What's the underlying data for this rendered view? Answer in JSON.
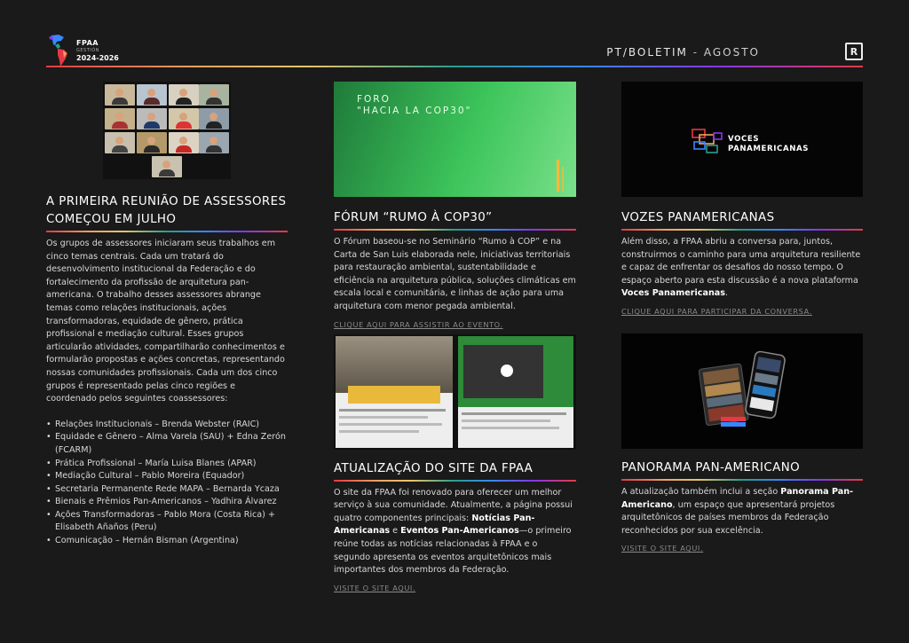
{
  "header": {
    "logo": {
      "line1": "FPAA",
      "line2": "GESTIÓN",
      "line3": "2024-2026"
    },
    "title": "PT/BOLETIM",
    "separator": "-",
    "month": "AGOSTO",
    "icon_letter": "R"
  },
  "col1": {
    "heading_line1": "A PRIMEIRA REUNIÃO DE ASSESSORES",
    "heading_line2": "COMEÇOU EM JULHO",
    "body": "Os grupos de assessores iniciaram seus trabalhos em cinco temas centrais. Cada um tratará do desenvolvimento institucional da Federação e do fortalecimento da profissão de arquitetura pan-americana. O trabalho desses assessores abrange temas como relações institucionais, ações transformadoras, equidade de gênero, prática profissional e mediação cultural. Esses grupos articularão atividades, compartilharão conhecimentos e formularão propostas e ações concretas, representando nossas comunidades profissionais. Cada um dos cinco grupos é representado pelas cinco regiões e coordenado pelos seguintes coassessores:",
    "bullets": [
      "Relações Institucionais – Brenda Webster (RAIC)",
      "Equidade e Gênero – Alma Varela (SAU) + Edna Zerón (FCARM)",
      "Prática Profissional – María Luisa Blanes (APAR)",
      "Mediação Cultural – Pablo Moreira (Equador)",
      "Secretaria Permanente Rede MAPA – Bernarda Ycaza",
      "Bienais e Prêmios Pan-Americanos – Yadhira Álvarez",
      "Ações Transformadoras – Pablo Mora (Costa Rica) + Elisabeth Añaños (Peru)",
      "Comunicação – Hernán Bisman (Argentina)"
    ]
  },
  "col2": {
    "banner_title": "FORO\n\"HACIA LA COP30\"",
    "heading1": "FÓRUM “RUMO À COP30”",
    "body1": "O Fórum baseou-se no Seminário “Rumo à COP” e na Carta de San Luis elaborada nele, iniciativas territoriais para restauração ambiental, sustentabilidade e eficiência na arquitetura pública, soluções climáticas em escala local e comunitária, e linhas de ação para uma arquitetura com menor pegada ambiental.",
    "link1": "CLIQUE AQUI PARA ASSISTIR AO EVENTO.",
    "heading2": "ATUALIZAÇÃO DO SITE DA FPAA",
    "body2_a": "O site da FPAA foi renovado para oferecer um melhor serviço à sua comunidade. Atualmente, a página possui quatro componentes principais: ",
    "body2_b1": "Notícias Pan-Americanas",
    "body2_c": " e ",
    "body2_b2": "Eventos Pan-Americanos",
    "body2_d": "—o primeiro reúne todas as notícias relacionadas à FPAA e o segundo apresenta os eventos arquitetônicos mais importantes dos membros da Federação.",
    "link2": "VISITE O SITE AQUI."
  },
  "col3": {
    "voces_logo": "VOCES\nPANAMERICANAS",
    "heading1": "VOZES PANAMERICANAS",
    "body1_a": "Além disso, a FPAA abriu a conversa para, juntos, construirmos o caminho para uma arquitetura resiliente e capaz de enfrentar os desafios do nosso tempo. O espaço aberto para esta discussão é a nova plataforma ",
    "body1_b": "Voces Panamericanas",
    "body1_c": ".",
    "link1": "CLIQUE AQUI PARA PARTICIPAR DA CONVERSA.",
    "heading2": "PANORAMA PAN-AMERICANO",
    "body2_a": "A atualização também inclui a seção ",
    "body2_b": "Panorama Pan-Americano",
    "body2_c": ", um espaço que apresentará projetos arquitetônicos de países membros da Federação reconhecidos por sua excelência.",
    "link2": "VISITE O SITE AQUI."
  },
  "colors": {
    "background": "#1a1a1a",
    "green_banner": "#3cc45a",
    "accent_orange": "#f6b93b"
  }
}
